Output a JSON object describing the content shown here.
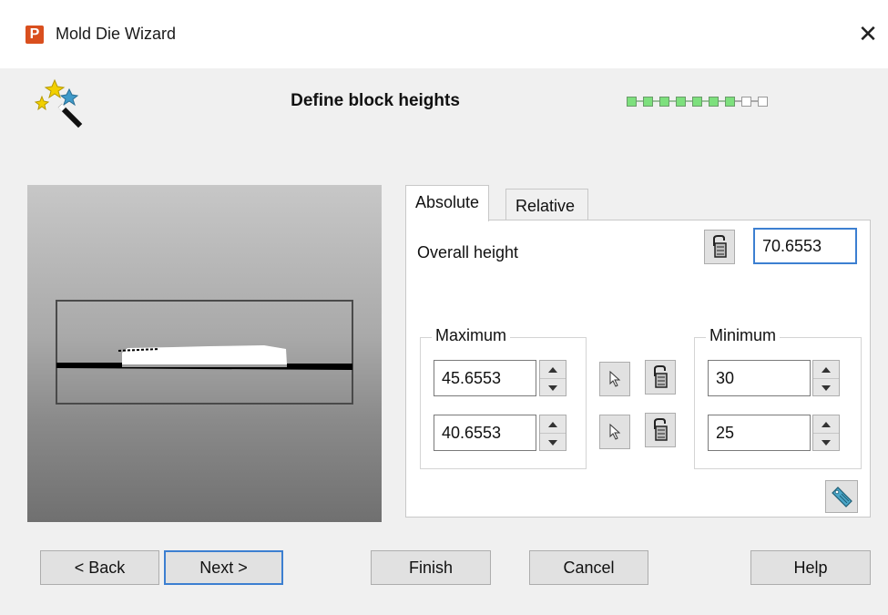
{
  "window": {
    "title": "Mold Die Wizard",
    "app_icon_letter": "P",
    "close_glyph": "✕"
  },
  "header": {
    "heading": "Define block heights",
    "progress": {
      "total_steps": 9,
      "completed_steps": 7
    }
  },
  "tabs": [
    {
      "label": "Absolute",
      "selected": true
    },
    {
      "label": "Relative",
      "selected": false
    }
  ],
  "absolute": {
    "overall_height_label": "Overall height",
    "overall_height_value": "70.6553",
    "maximum": {
      "legend": "Maximum",
      "top_value": "45.6553",
      "bottom_value": "40.6553"
    },
    "minimum": {
      "legend": "Minimum",
      "top_value": "30",
      "bottom_value": "25"
    }
  },
  "icons": {
    "measure": "measure-icon",
    "pick": "cursor-arrow-icon",
    "tag": "tag-icon",
    "wizard": "magic-wand-icon"
  },
  "buttons": {
    "back": "< Back",
    "next": "Next >",
    "finish": "Finish",
    "cancel": "Cancel",
    "help": "Help"
  },
  "colors": {
    "accent": "#3c7fd1",
    "progress_done": "#7de07d",
    "brand": "#d94f1e"
  }
}
